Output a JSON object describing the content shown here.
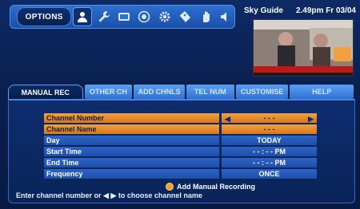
{
  "header": {
    "options_label": "OPTIONS",
    "app_title": "Sky Guide",
    "datetime": "2.49pm Fr 03/04",
    "icons": [
      "person-icon",
      "wrench-icon",
      "tv-icon",
      "target-icon",
      "gear-icon",
      "ticket-icon",
      "hand-icon",
      "speaker-icon"
    ]
  },
  "tabs": [
    {
      "label": "MANUAL REC",
      "active": true
    },
    {
      "label": "OTHER CH",
      "active": false
    },
    {
      "label": "ADD CHNLS",
      "active": false
    },
    {
      "label": "TEL NUM",
      "active": false
    },
    {
      "label": "CUSTOMISE",
      "active": false
    },
    {
      "label": "HELP",
      "active": false
    }
  ],
  "form": {
    "rows": [
      {
        "label": "Channel Number",
        "value": "- - -"
      },
      {
        "label": "Channel Name",
        "value": "- - -"
      },
      {
        "label": "Day",
        "value": "TODAY"
      },
      {
        "label": "Start Time",
        "value": "- - : - - PM"
      },
      {
        "label": "End Time",
        "value": "- - : - - PM"
      },
      {
        "label": "Frequency",
        "value": "ONCE"
      }
    ],
    "add_manual_label": "Add Manual Recording",
    "hint": "Enter channel number or ◀ ▶ to choose channel name"
  },
  "colors": {
    "highlight": "#f0a040",
    "button_dot": "#f7a030",
    "accent": "#2f72d4"
  }
}
